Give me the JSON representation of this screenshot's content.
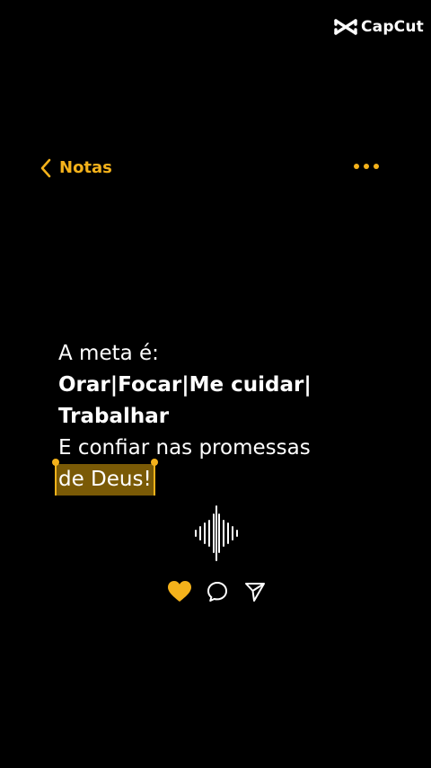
{
  "watermark": {
    "brand": "CapCut"
  },
  "nav": {
    "back_label": "Notas",
    "back_icon": "chevron-left-icon",
    "more_icon": "more-horizontal-icon"
  },
  "note": {
    "line1": "A meta é:",
    "line2": "Orar|Focar|Me cuidar|",
    "line3": "Trabalhar",
    "line4": "E confiar nas promessas",
    "line5_selected": "de Deus!"
  },
  "actions": {
    "like_icon": "heart-icon",
    "comment_icon": "comment-icon",
    "share_icon": "send-icon"
  },
  "colors": {
    "accent": "#f4b21b",
    "selection_bg": "#7a5a06",
    "background": "#000000",
    "text": "#ffffff"
  }
}
